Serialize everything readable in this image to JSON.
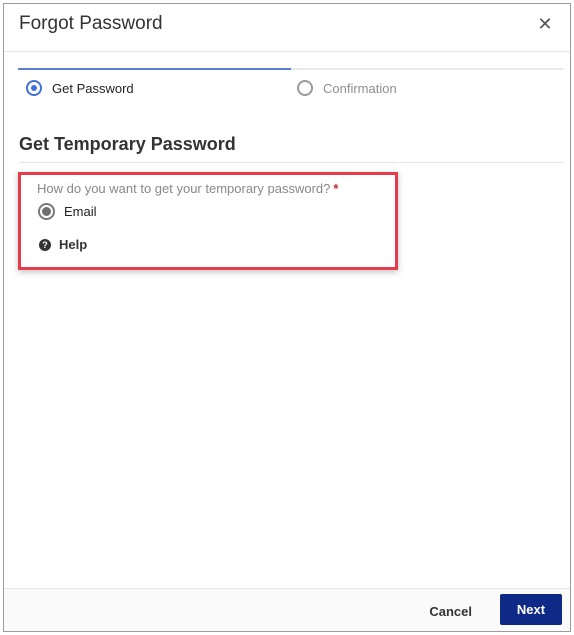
{
  "dialog": {
    "title": "Forgot Password",
    "close_icon": "close-icon"
  },
  "steps": [
    {
      "label": "Get Password",
      "active": true
    },
    {
      "label": "Confirmation",
      "active": false
    }
  ],
  "section": {
    "title": "Get Temporary Password",
    "question": "How do you want to get your temporary password?",
    "required_marker": "*",
    "options": [
      {
        "label": "Email",
        "selected": true
      }
    ],
    "help_label": "Help"
  },
  "footer": {
    "cancel_label": "Cancel",
    "next_label": "Next"
  },
  "colors": {
    "accent": "#3f72d6",
    "primary_button": "#0f2a86",
    "highlight_border": "#e53b4a",
    "required": "#cc2b2b"
  }
}
